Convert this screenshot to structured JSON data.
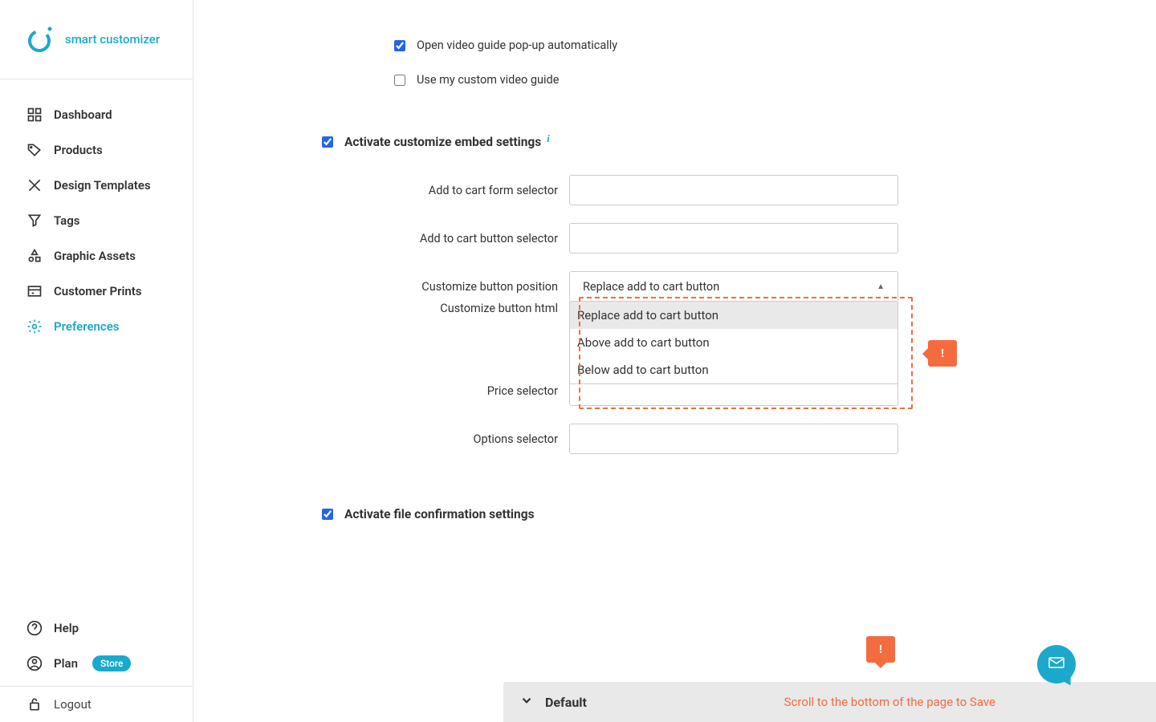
{
  "brand": {
    "name": "smart customizer"
  },
  "sidebar": {
    "items": [
      {
        "label": "Dashboard"
      },
      {
        "label": "Products"
      },
      {
        "label": "Design Templates"
      },
      {
        "label": "Tags"
      },
      {
        "label": "Graphic Assets"
      },
      {
        "label": "Customer Prints"
      },
      {
        "label": "Preferences"
      }
    ],
    "bottom": {
      "help": "Help",
      "plan": "Plan",
      "plan_badge": "Store",
      "logout": "Logout"
    }
  },
  "checks": {
    "open_video": {
      "label": "Open video guide pop-up automatically",
      "checked": true
    },
    "custom_video": {
      "label": "Use my custom video guide",
      "checked": false
    },
    "activate_embed": {
      "label": "Activate customize embed settings",
      "checked": true
    },
    "activate_file": {
      "label": "Activate file confirmation settings",
      "checked": true
    }
  },
  "fields": {
    "cart_form": {
      "label": "Add to cart form selector",
      "value": ""
    },
    "cart_button": {
      "label": "Add to cart button selector",
      "value": ""
    },
    "button_pos": {
      "label": "Customize button position",
      "selected": "Replace add to cart button",
      "options": [
        "Replace add to cart button",
        "Above add to cart button",
        "Below add to cart button"
      ]
    },
    "button_html": {
      "label": "Customize button html",
      "value": ""
    },
    "price_sel": {
      "label": "Price selector",
      "value": ""
    },
    "options_sel": {
      "label": "Options selector",
      "value": ""
    }
  },
  "accordion": {
    "title": "Default"
  },
  "hints": {
    "save": "Scroll to the bottom of the page to Save",
    "bang": "!"
  }
}
